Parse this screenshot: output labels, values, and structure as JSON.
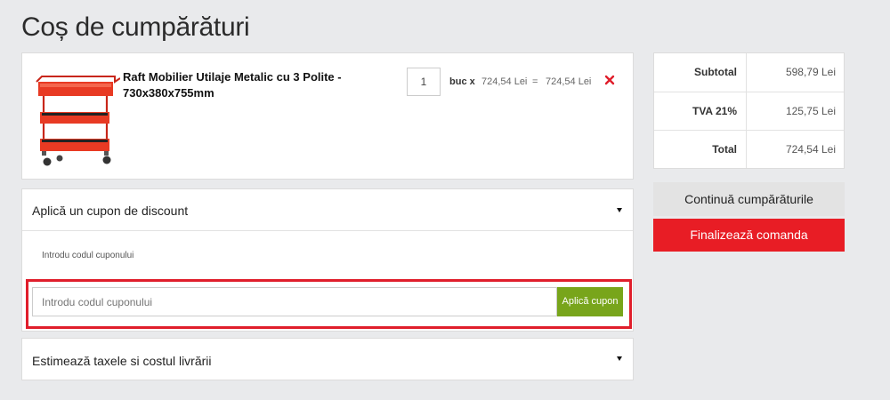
{
  "page": {
    "title": "Coș de cumpărături"
  },
  "cart": {
    "items": [
      {
        "name": "Raft Mobilier Utilaje Metalic cu 3 Polite - 730x380x755mm",
        "quantity": "1",
        "unit": "buc x",
        "unit_price": "724,54 Lei",
        "equals": "=",
        "line_total": "724,54 Lei",
        "image_icon": "red-tool-cart-image",
        "remove_icon": "close-icon"
      }
    ]
  },
  "totals": {
    "subtotal_label": "Subtotal",
    "subtotal_value": "598,79 Lei",
    "tax_label": "TVA 21%",
    "tax_value": "125,75 Lei",
    "total_label": "Total",
    "total_value": "724,54 Lei"
  },
  "actions": {
    "continue_label": "Continuă cumpărăturile",
    "checkout_label": "Finalizează comanda"
  },
  "coupon": {
    "title": "Aplică un cupon de discount",
    "label": "Introdu codul cuponului",
    "input_placeholder": "Introdu codul cuponului",
    "input_value": "",
    "apply_label": "Aplică cupon"
  },
  "shipping": {
    "title": "Estimează taxele si costul livrării"
  },
  "colors": {
    "background": "#e9eaec",
    "checkout": "#e81d25",
    "apply": "#78a51b",
    "highlight": "#e01e2b"
  }
}
